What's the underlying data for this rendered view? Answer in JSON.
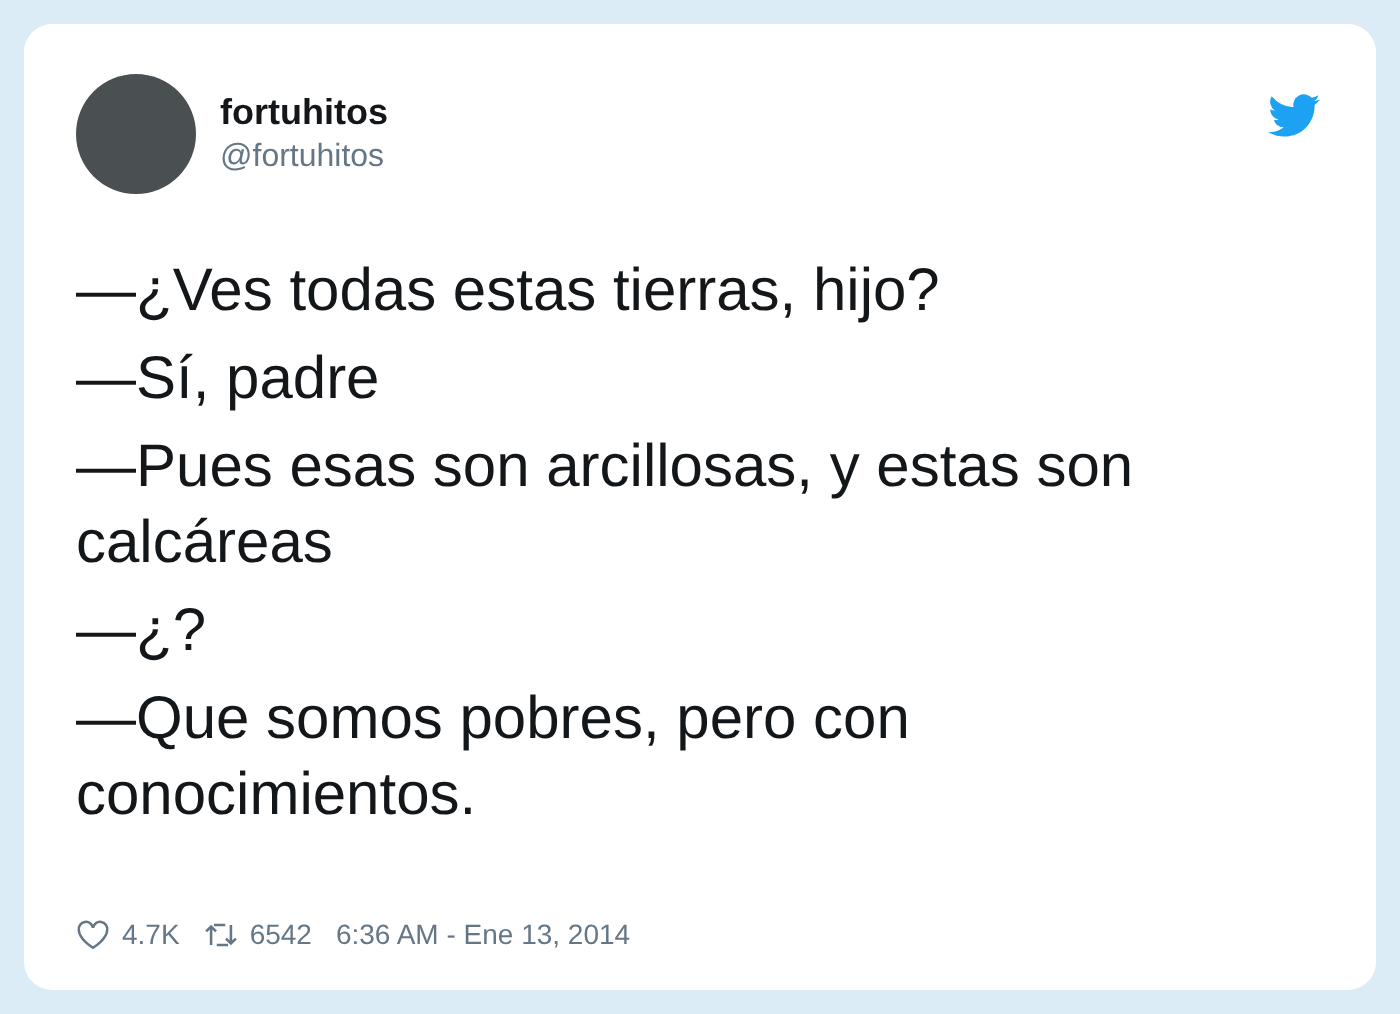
{
  "author": {
    "name": "fortuhitos",
    "handle": "@fortuhitos"
  },
  "tweet": {
    "lines": [
      "—¿Ves todas estas tierras, hijo?",
      "—Sí, padre",
      "—Pues esas son arcillosas, y estas son calcáreas",
      "—¿?",
      "—Que somos pobres, pero con conocimientos."
    ]
  },
  "footer": {
    "likes": "4.7K",
    "retweets": "6542",
    "timestamp": "6:36 AM - Ene 13, 2014"
  }
}
